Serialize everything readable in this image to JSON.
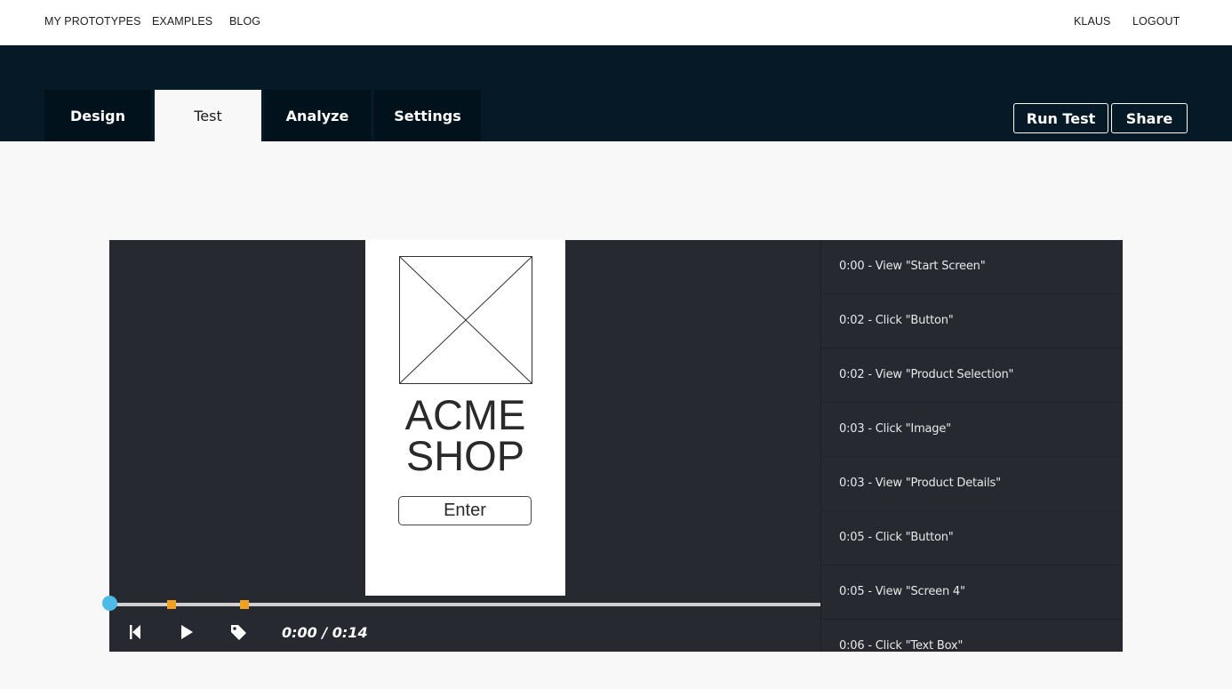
{
  "topnav": {
    "my_prototypes": "MY PROTOTYPES",
    "examples": "EXAMPLES",
    "blog": "BLOG",
    "user": "KLAUS",
    "logout": "LOGOUT"
  },
  "tabs": [
    {
      "label": "Design"
    },
    {
      "label": "Test"
    },
    {
      "label": "Analyze"
    },
    {
      "label": "Settings"
    }
  ],
  "active_tab": "Test",
  "actions": {
    "run_test": "Run Test",
    "share": "Share"
  },
  "prototype": {
    "title_line1": "ACME",
    "title_line2": "SHOP",
    "button": "Enter"
  },
  "player": {
    "time": "0:00 / 0:14",
    "progress": 0.0,
    "colors": {
      "knob": "#4cbbe8",
      "marker": "#f0a020"
    }
  },
  "events": [
    "0:00 - View \"Start Screen\"",
    "0:02 - Click \"Button\"",
    "0:02 - View \"Product Selection\"",
    "0:03 - Click \"Image\"",
    "0:03 - View \"Product Details\"",
    "0:05 - Click \"Button\"",
    "0:05 - View \"Screen 4\"",
    "0:06 - Click \"Text Box\""
  ]
}
